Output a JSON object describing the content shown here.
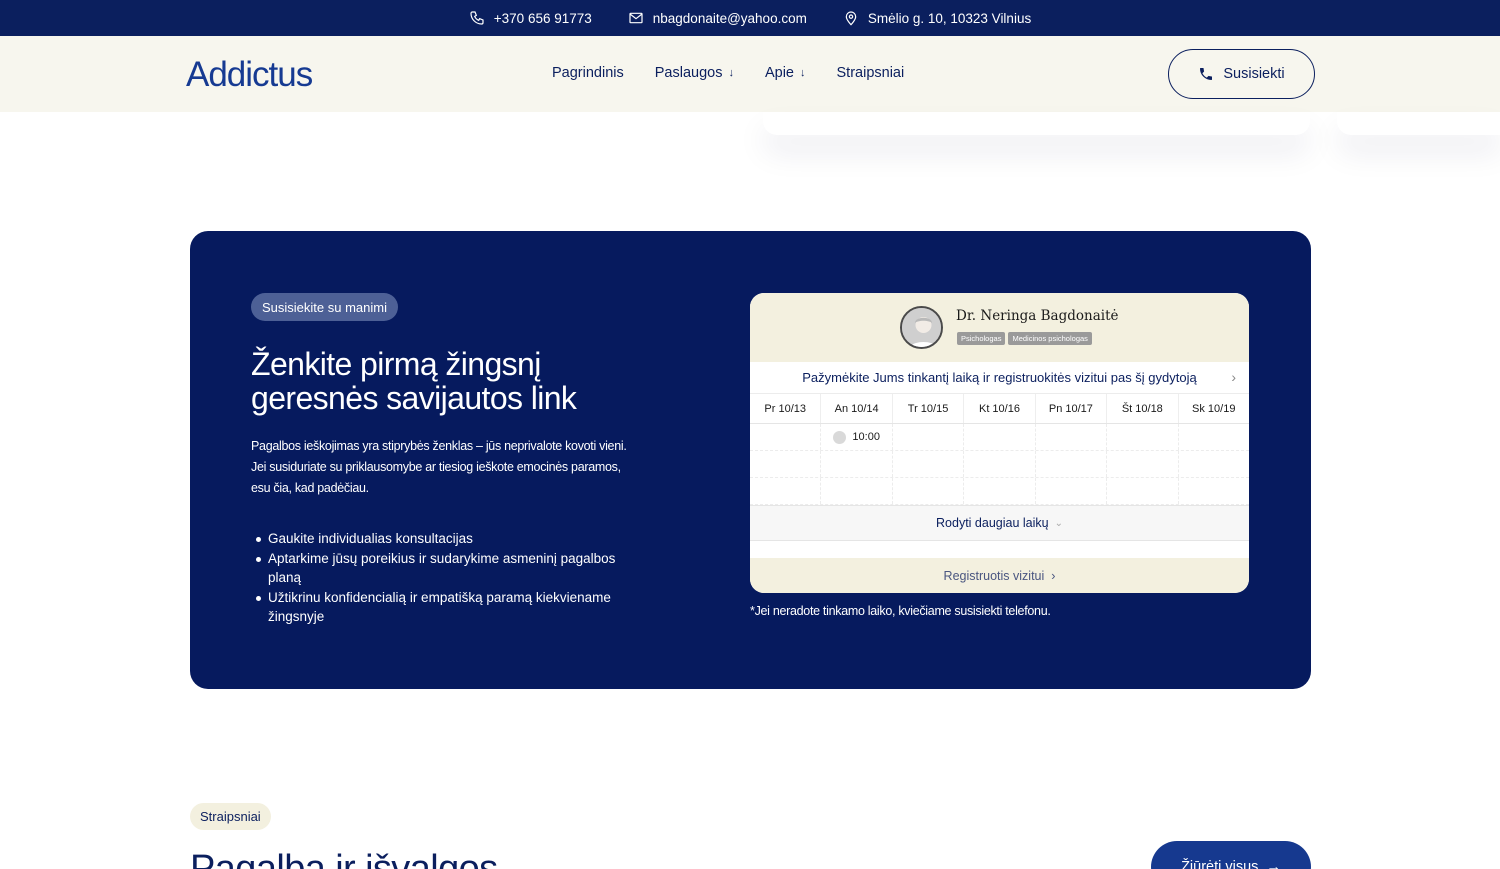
{
  "topbar": {
    "phone": "+370 656 91773",
    "email": "nbagdonaite@yahoo.com",
    "address": "Smėlio g. 10, 10323 Vilnius"
  },
  "header": {
    "logo": "Addictus",
    "nav": [
      {
        "label": "Pagrindinis"
      },
      {
        "label": "Paslaugos"
      },
      {
        "label": "Apie"
      },
      {
        "label": "Straipsniai"
      }
    ],
    "contact_button": "Susisiekti"
  },
  "cta": {
    "pill": "Susisiekite su manimi",
    "title": "Ženkite pirmą žingsnį geresnės savijautos link",
    "description": "Pagalbos ieškojimas yra stiprybės ženklas – jūs neprivalote kovoti vieni. Jei susiduriate su priklausomybe ar tiesiog ieškote emocinės paramos, esu čia, kad padėčiau.",
    "bullets": [
      "Gaukite individualias konsultacijas",
      "Aptarkime jūsų poreikius ir sudarykime asmeninį pagalbos planą",
      "Užtikrinu konfidencialią ir empatišką paramą kiekviename žingsnyje"
    ],
    "note": "*Jei neradote tinkamo laiko, kviečiame susisiekti telefonu."
  },
  "widget": {
    "doctor_name": "Dr. Neringa Bagdonaitė",
    "tags": [
      "Psichologas",
      "Medicinos psichologas"
    ],
    "subtitle": "Pažymėkite Jums tinkantį laiką ir registruokitės vizitui pas šį gydytoją",
    "days": [
      "Pr 10/13",
      "An 10/14",
      "Tr 10/15",
      "Kt 10/16",
      "Pn 10/17",
      "Št 10/18",
      "Sk 10/19"
    ],
    "slot": "10:00",
    "more_label": "Rodyti daugiau laikų",
    "register_label": "Registruotis vizitui"
  },
  "articles": {
    "pill": "Straipsniai",
    "title": "Pagalba ir išvalgos",
    "view_all": "Žiūrėti visus"
  },
  "colors": {
    "navy": "#061a5e",
    "accent_blue": "#16398f",
    "cream": "#f3f0df"
  }
}
